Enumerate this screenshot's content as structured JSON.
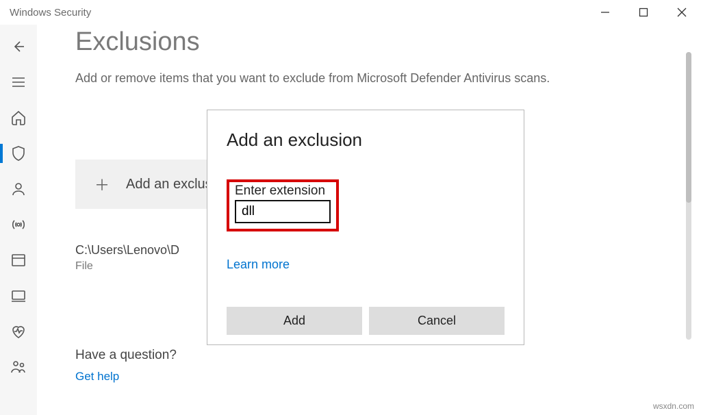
{
  "window": {
    "title": "Windows Security"
  },
  "page": {
    "title": "Exclusions",
    "description": "Add or remove items that you want to exclude from Microsoft Defender Antivirus scans.",
    "add_button_label": "Add an exclusion"
  },
  "exclusion": {
    "path": "C:\\Users\\Lenovo\\D",
    "type": "File"
  },
  "help": {
    "heading": "Have a question?",
    "link": "Get help"
  },
  "dialog": {
    "title": "Add an exclusion",
    "field_label": "Enter extension",
    "field_value": "dll",
    "learn_more": "Learn more",
    "add": "Add",
    "cancel": "Cancel"
  },
  "watermark": "wsxdn.com"
}
